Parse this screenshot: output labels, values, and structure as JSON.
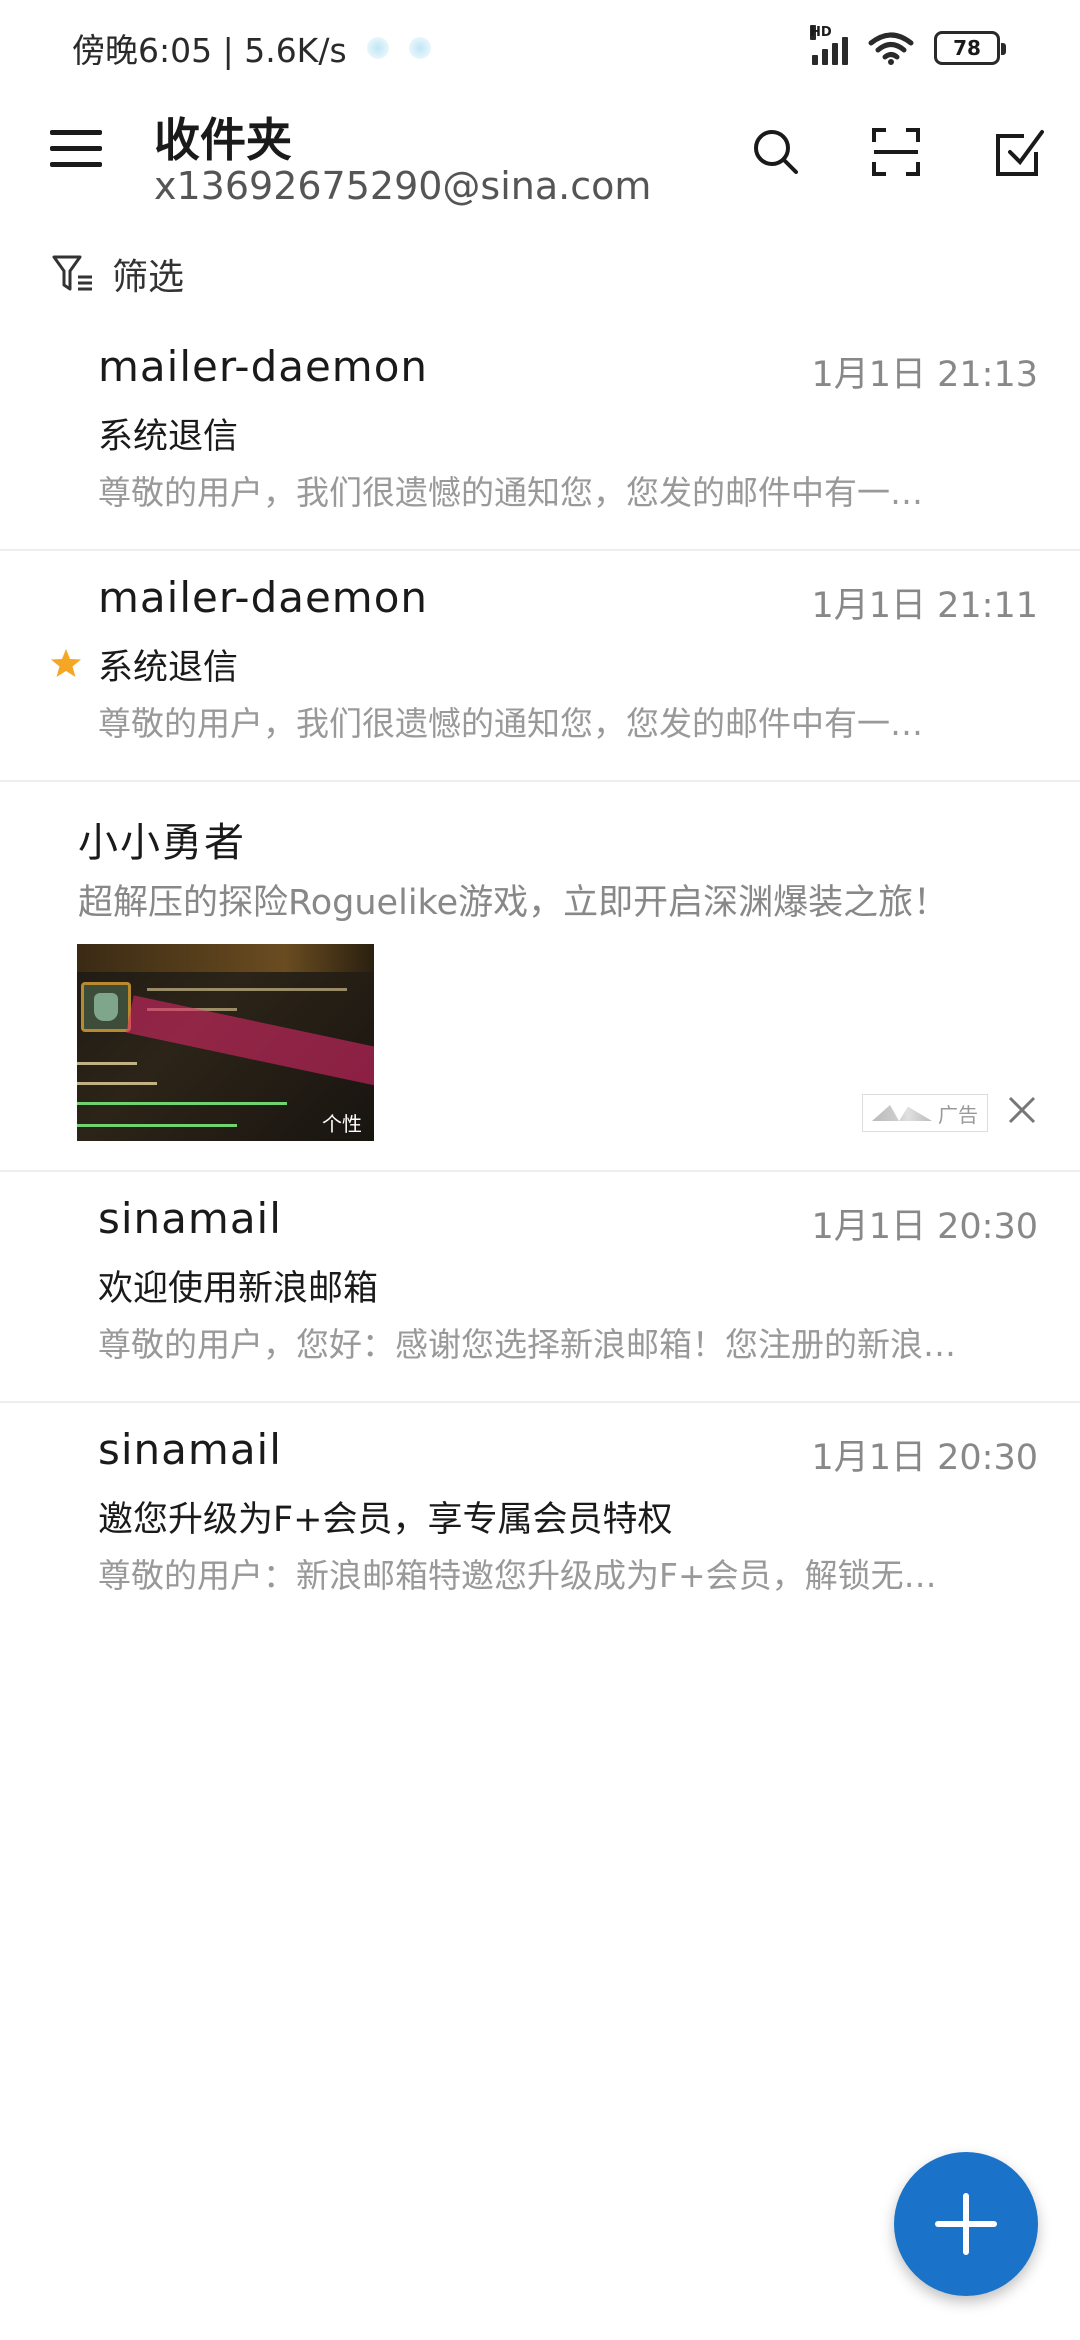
{
  "status_bar": {
    "time_network": "傍晚6:05 | 5.6K/s",
    "battery_level": "78",
    "signal_label": "HD"
  },
  "header": {
    "title": "收件夹",
    "account": "x13692675290@sina.com"
  },
  "filter": {
    "label": "筛选"
  },
  "emails": [
    {
      "sender": "mailer-daemon",
      "time": "1月1日 21:13",
      "subject": "系统退信",
      "preview": "尊敬的用户，我们很遗憾的通知您，您发的邮件中有一…",
      "starred": false
    },
    {
      "sender": "mailer-daemon",
      "time": "1月1日 21:11",
      "subject": "系统退信",
      "preview": "尊敬的用户，我们很遗憾的通知您，您发的邮件中有一…",
      "starred": true
    },
    {
      "sender": "sinamail",
      "time": "1月1日 20:30",
      "subject": "欢迎使用新浪邮箱",
      "preview": "尊敬的用户，您好：感谢您选择新浪邮箱！您注册的新浪…",
      "starred": false
    },
    {
      "sender": "sinamail",
      "time": "1月1日 20:30",
      "subject": "邀您升级为F+会员，享专属会员特权",
      "preview": "尊敬的用户：新浪邮箱特邀您升级成为F+会员，解锁无…",
      "starred": false
    }
  ],
  "ad": {
    "title": "小小勇者",
    "description": "超解压的探险Roguelike游戏，立即开启深渊爆装之旅！",
    "badge": "广告",
    "image_tag": "个性"
  },
  "colors": {
    "accent": "#1a73c8",
    "star": "#f5a623",
    "muted": "#999999"
  }
}
